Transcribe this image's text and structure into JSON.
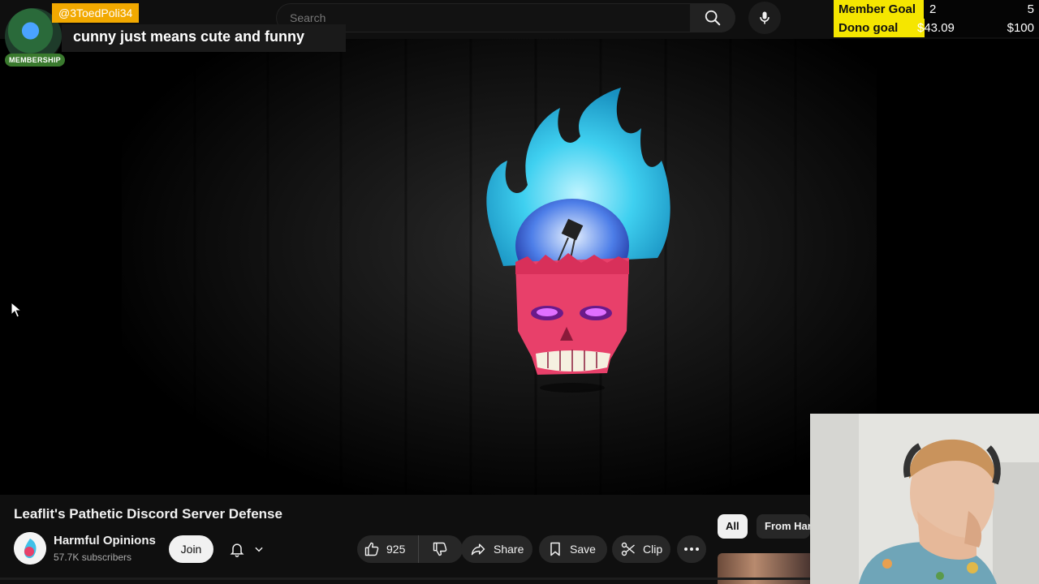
{
  "search": {
    "placeholder": "Search"
  },
  "icons": {
    "search": "search-icon",
    "mic": "microphone-icon",
    "like": "thumbs-up-icon",
    "dislike": "thumbs-down-icon",
    "share": "share-arrow-icon",
    "save": "bookmark-icon",
    "clip": "scissors-icon",
    "more": "more-horizontal-icon",
    "bell": "bell-icon",
    "chevron": "chevron-down-icon"
  },
  "alert": {
    "username": "@3ToedPoli34",
    "badge": "MEMBERSHIP",
    "message": "cunny just means cute and funny"
  },
  "goals": [
    {
      "label": "Member Goal",
      "current": "2",
      "target": "5",
      "progress": 0.4
    },
    {
      "label": "Dono goal",
      "current": "$43.09",
      "target": "$100",
      "progress": 0.43
    }
  ],
  "video": {
    "title": "Leaflit's Pathetic Discord Server Defense"
  },
  "channel": {
    "name": "Harmful Opinions",
    "subscribers": "57.7K subscribers",
    "join_label": "Join"
  },
  "actions": {
    "like_count": "925",
    "share_label": "Share",
    "save_label": "Save",
    "clip_label": "Clip"
  },
  "chips": {
    "all": "All",
    "from": "From Harmful Opinions"
  },
  "colors": {
    "background": "#0f0f0f",
    "goal_yellow": "#f5e600",
    "alert_orange": "#f2a900",
    "flame_blue": "#3fd0f0",
    "skull_pink": "#e8406a"
  }
}
